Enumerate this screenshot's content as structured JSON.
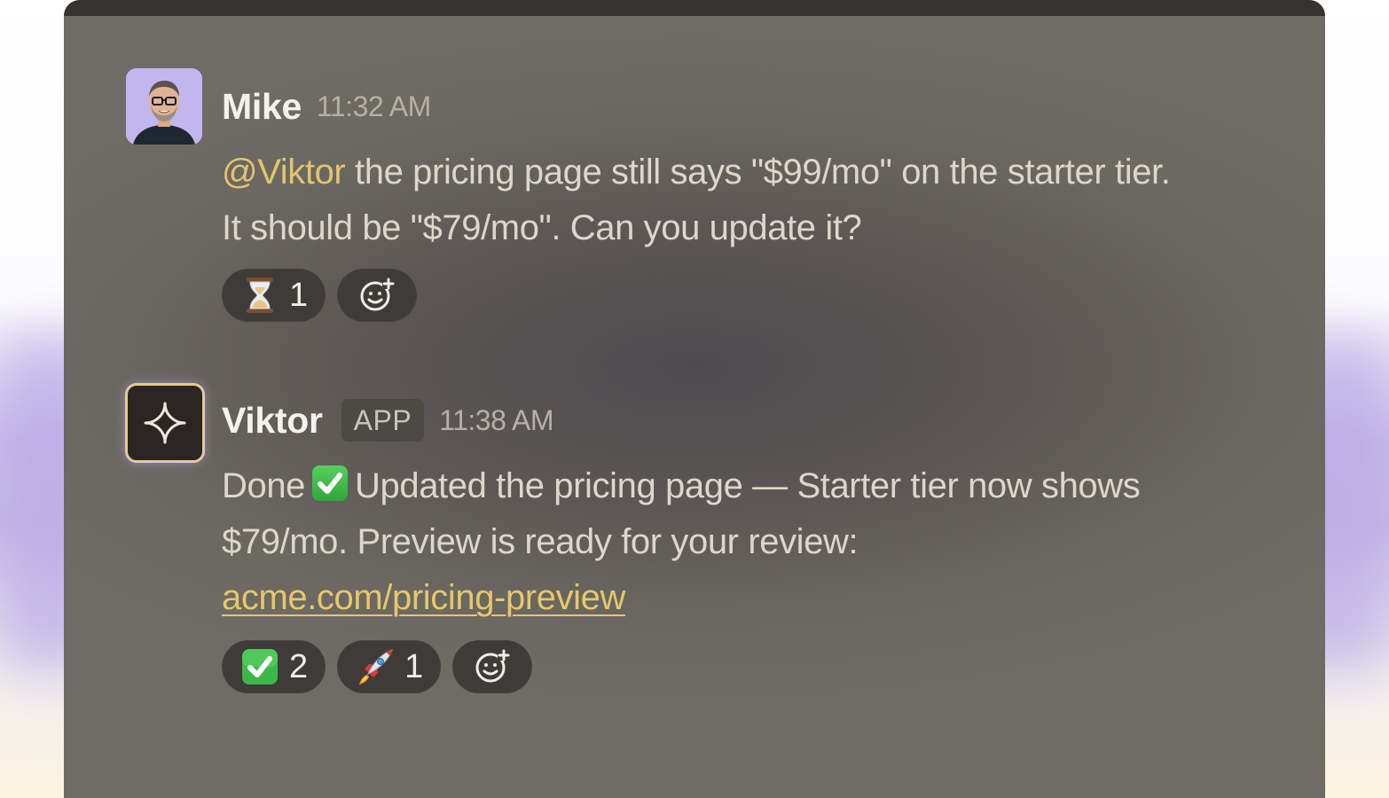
{
  "colors": {
    "window_bg": "#6b6761",
    "mention": "#e3c46b",
    "link": "#e6c76b",
    "text": "#dcd6cc",
    "pill_bg": "#3f3b38"
  },
  "messages": [
    {
      "username": "Mike",
      "timestamp": "11:32 AM",
      "avatar": "person-photo",
      "mention": "@Viktor",
      "line1_rest": " the pricing page still says \"$99/mo\" on the starter tier.",
      "line2": "It should be \"$79/mo\". Can you update it?",
      "reactions": [
        {
          "emoji": "hourglass-icon",
          "count": "1"
        },
        {
          "emoji": "add-reaction-icon",
          "count": ""
        }
      ]
    },
    {
      "username": "Viktor",
      "badge": "APP",
      "timestamp": "11:38 AM",
      "avatar": "sparkle-icon",
      "line1_start": "Done",
      "line1_rest": "Updated the pricing page — Starter tier now shows",
      "line2": "$79/mo. Preview is ready for your review:",
      "link": "acme.com/pricing-preview",
      "reactions": [
        {
          "emoji": "check-mark-icon",
          "count": "2"
        },
        {
          "emoji": "rocket-icon",
          "count": "1"
        },
        {
          "emoji": "add-reaction-icon",
          "count": ""
        }
      ]
    }
  ]
}
